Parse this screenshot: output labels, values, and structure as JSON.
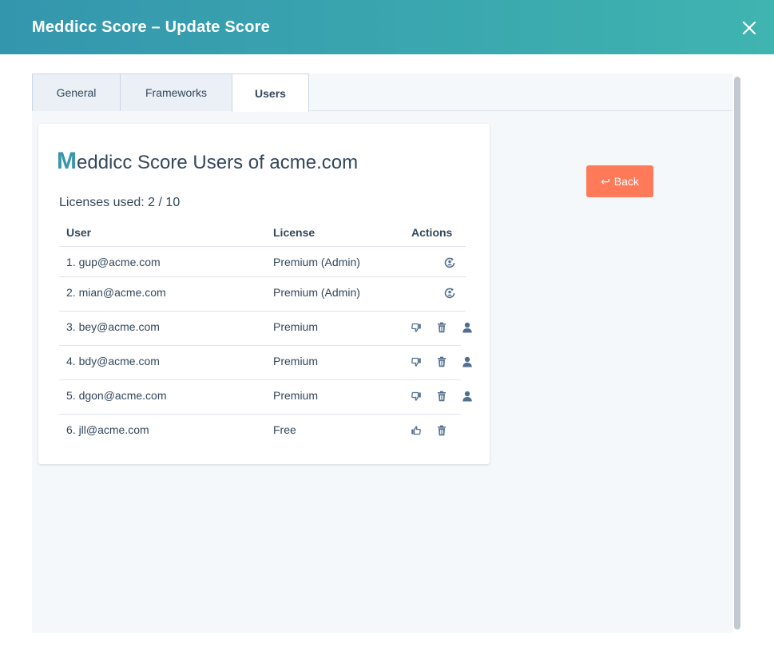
{
  "dialog": {
    "title": "Meddicc Score – Update Score"
  },
  "tabs": [
    {
      "label": "General",
      "active": false
    },
    {
      "label": "Frameworks",
      "active": false
    },
    {
      "label": "Users",
      "active": true
    }
  ],
  "card": {
    "title_initial": "M",
    "title_rest": "eddicc Score Users of acme.com",
    "licenses_used": "Licenses used: 2 / 10"
  },
  "table": {
    "headers": {
      "user": "User",
      "license": "License",
      "actions": "Actions"
    },
    "rows": [
      {
        "user": "1. gup@acme.com",
        "license": "Premium (Admin)",
        "actions": [
          "switch-user-icon"
        ]
      },
      {
        "user": "2. mian@acme.com",
        "license": "Premium (Admin)",
        "actions": [
          "switch-user-icon"
        ]
      },
      {
        "user": "3. bey@acme.com",
        "license": "Premium",
        "actions": [
          "thumbs-down-icon",
          "trash-icon",
          "user-icon"
        ]
      },
      {
        "user": "4. bdy@acme.com",
        "license": "Premium",
        "actions": [
          "thumbs-down-icon",
          "trash-icon",
          "user-icon"
        ]
      },
      {
        "user": "5. dgon@acme.com",
        "license": "Premium",
        "actions": [
          "thumbs-down-icon",
          "trash-icon",
          "user-icon"
        ]
      },
      {
        "user": "6. jll@acme.com",
        "license": "Free",
        "actions": [
          "thumbs-up-icon",
          "trash-icon"
        ]
      }
    ]
  },
  "back_button": {
    "label": "Back",
    "icon": "return-arrow-icon"
  },
  "colors": {
    "header_gradient_start": "#3496ad",
    "header_gradient_end": "#3fb4b0",
    "accent_m": "#3896ad",
    "back_button": "#ff7a59",
    "icon": "#516f90"
  }
}
